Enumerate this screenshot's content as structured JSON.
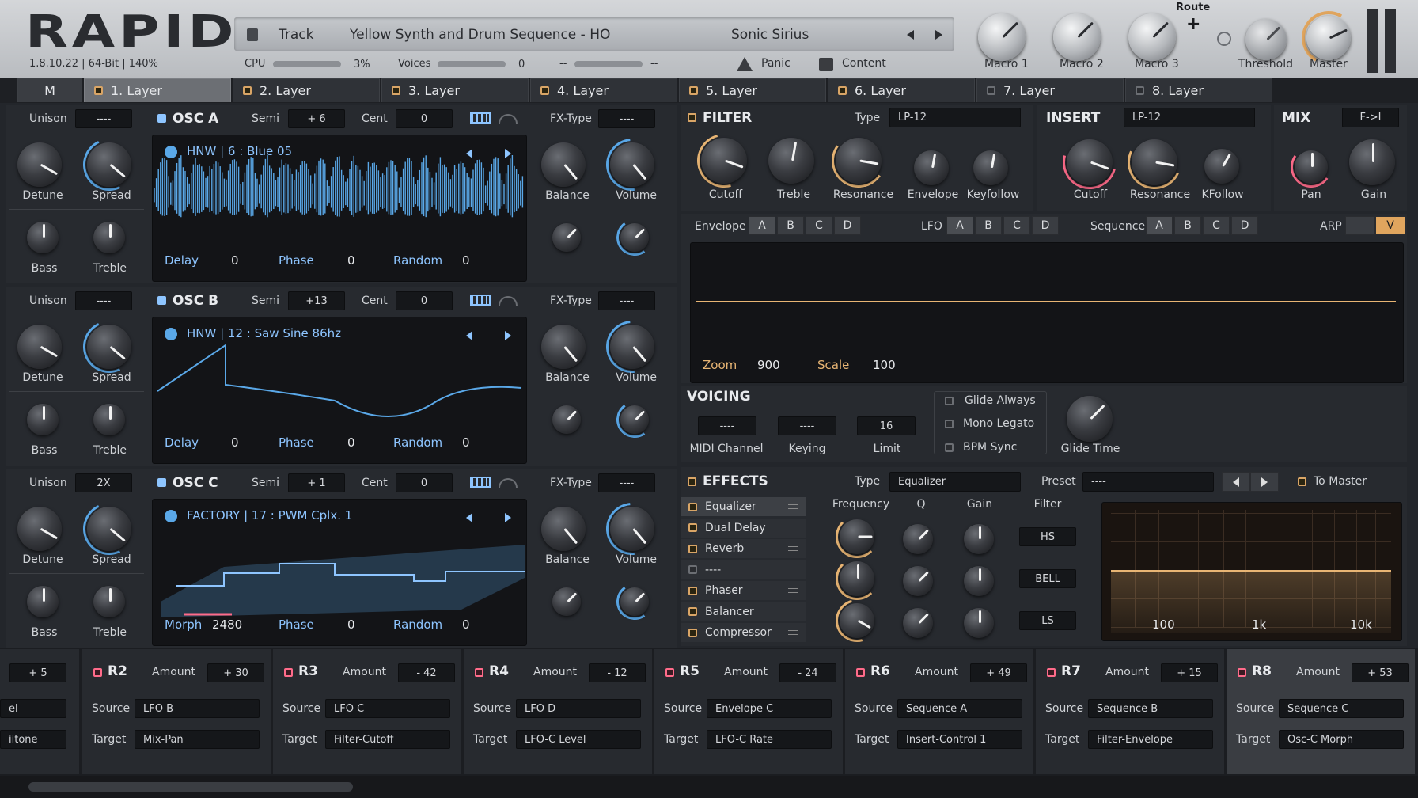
{
  "header": {
    "logo": "RAPID",
    "version": "1.8.10.22 | 64-Bit | 140%",
    "track_label": "Track",
    "track_name": "Yellow Synth and Drum Sequence - HO",
    "author": "Sonic Sirius",
    "cpu_label": "CPU",
    "cpu_value": "3%",
    "voices_label": "Voices",
    "voices_value": "0",
    "dash1": "--",
    "dash2": "--",
    "panic": "Panic",
    "content": "Content",
    "route": "Route",
    "macros": [
      "Macro 1",
      "Macro 2",
      "Macro 3"
    ],
    "threshold": "Threshold",
    "master": "Master"
  },
  "tabs": [
    "M",
    "1. Layer",
    "2. Layer",
    "3. Layer",
    "4. Layer",
    "5. Layer",
    "6. Layer",
    "7. Layer",
    "8. Layer"
  ],
  "osc": [
    {
      "title": "OSC A",
      "semi_label": "Semi",
      "semi": "+ 6",
      "cent_label": "Cent",
      "cent": "0",
      "fxtype_label": "FX-Type",
      "fxtype": "----",
      "unison_label": "Unison",
      "unison": "----",
      "wave_name": "HNW | 6 : Blue 05",
      "p1_label": "Delay",
      "p1": "0",
      "phase_label": "Phase",
      "phase": "0",
      "random_label": "Random",
      "random": "0",
      "detune": "Detune",
      "spread": "Spread",
      "bass": "Bass",
      "treble": "Treble",
      "balance": "Balance",
      "volume": "Volume"
    },
    {
      "title": "OSC B",
      "semi_label": "Semi",
      "semi": "+13",
      "cent_label": "Cent",
      "cent": "0",
      "fxtype_label": "FX-Type",
      "fxtype": "----",
      "unison_label": "Unison",
      "unison": "----",
      "wave_name": "HNW | 12 : Saw Sine 86hz",
      "p1_label": "Delay",
      "p1": "0",
      "phase_label": "Phase",
      "phase": "0",
      "random_label": "Random",
      "random": "0",
      "detune": "Detune",
      "spread": "Spread",
      "bass": "Bass",
      "treble": "Treble",
      "balance": "Balance",
      "volume": "Volume"
    },
    {
      "title": "OSC C",
      "semi_label": "Semi",
      "semi": "+ 1",
      "cent_label": "Cent",
      "cent": "0",
      "fxtype_label": "FX-Type",
      "fxtype": "----",
      "unison_label": "Unison",
      "unison": "2X",
      "wave_name": "FACTORY | 17 : PWM Cplx. 1",
      "p1_label": "Morph",
      "p1": "2480",
      "phase_label": "Phase",
      "phase": "0",
      "random_label": "Random",
      "random": "0",
      "detune": "Detune",
      "spread": "Spread",
      "bass": "Bass",
      "treble": "Treble",
      "balance": "Balance",
      "volume": "Volume"
    }
  ],
  "filter": {
    "title": "FILTER",
    "type_label": "Type",
    "type": "LP-12",
    "knobs": [
      "Cutoff",
      "Treble",
      "Resonance",
      "Envelope",
      "Keyfollow"
    ]
  },
  "insert": {
    "title": "INSERT",
    "type": "LP-12",
    "knobs": [
      "Cutoff",
      "Resonance",
      "KFollow"
    ]
  },
  "mix": {
    "title": "MIX",
    "mode": "F->I",
    "knobs": [
      "Pan",
      "Gain"
    ]
  },
  "mod": {
    "envelope": "Envelope",
    "lfo": "LFO",
    "sequence": "Sequence",
    "arp": "ARP",
    "arp_v": "V",
    "letters": [
      "A",
      "B",
      "C",
      "D"
    ],
    "zoom_label": "Zoom",
    "zoom": "900",
    "scale_label": "Scale",
    "scale": "100"
  },
  "voicing": {
    "title": "VOICING",
    "midi": "----",
    "midi_label": "MIDI Channel",
    "keying": "----",
    "keying_label": "Keying",
    "limit": "16",
    "limit_label": "Limit",
    "glide_always": "Glide Always",
    "mono_legato": "Mono Legato",
    "bpm_sync": "BPM Sync",
    "glide_time": "Glide Time"
  },
  "effects": {
    "title": "EFFECTS",
    "type_label": "Type",
    "type": "Equalizer",
    "preset_label": "Preset",
    "preset": "----",
    "to_master": "To Master",
    "list": [
      "Equalizer",
      "Dual Delay",
      "Reverb",
      "----",
      "Phaser",
      "Balancer",
      "Compressor"
    ],
    "cols": [
      "Frequency",
      "Q",
      "Gain",
      "Filter"
    ],
    "filters": [
      "HS",
      "BELL",
      "LS"
    ],
    "freq_labels": [
      "100",
      "1k",
      "10k"
    ]
  },
  "routing": {
    "r1": {
      "amount": "+ 5",
      "source": "el",
      "target": "iitone"
    },
    "rows": [
      {
        "name": "R2",
        "amount": "+ 30",
        "source": "LFO B",
        "target": "Mix-Pan"
      },
      {
        "name": "R3",
        "amount": "- 42",
        "source": "LFO C",
        "target": "Filter-Cutoff"
      },
      {
        "name": "R4",
        "amount": "- 12",
        "source": "LFO D",
        "target": "LFO-C Level"
      },
      {
        "name": "R5",
        "amount": "- 24",
        "source": "Envelope C",
        "target": "LFO-C Rate"
      },
      {
        "name": "R6",
        "amount": "+ 49",
        "source": "Sequence A",
        "target": "Insert-Control 1"
      },
      {
        "name": "R7",
        "amount": "+ 15",
        "source": "Sequence B",
        "target": "Filter-Envelope"
      },
      {
        "name": "R8",
        "amount": "+ 53",
        "source": "Sequence C",
        "target": "Osc-C Morph"
      }
    ],
    "amount_label": "Amount",
    "source_label": "Source",
    "target_label": "Target"
  }
}
